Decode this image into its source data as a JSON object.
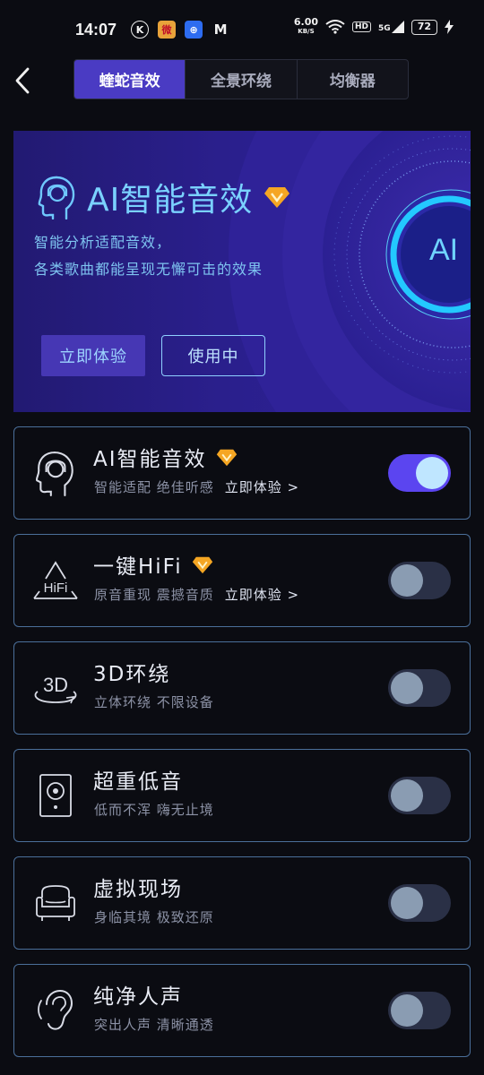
{
  "status_bar": {
    "time": "14:07",
    "app_icons": [
      "K",
      "微",
      "⊕",
      "M"
    ],
    "net_speed": "6.00",
    "net_unit": "KB/S",
    "hd": "HD",
    "signal": "5G",
    "battery": "72"
  },
  "tabs": [
    {
      "label": "蝰蛇音效",
      "active": true
    },
    {
      "label": "全景环绕",
      "active": false
    },
    {
      "label": "均衡器",
      "active": false
    }
  ],
  "banner": {
    "title": "AI智能音效",
    "desc_line1": "智能分析适配音效，",
    "desc_line2": "各类歌曲都能呈现无懈可击的效果",
    "try_button": "立即体验",
    "inuse_button": "使用中",
    "badge": "AI"
  },
  "effects": [
    {
      "title": "AI智能音效",
      "subtitle": "智能适配 绝佳听感",
      "link": "立即体验 >",
      "vip": true,
      "enabled": true,
      "icon": "ai-head-icon"
    },
    {
      "title": "一键HiFi",
      "subtitle": "原音重现 震撼音质",
      "link": "立即体验 >",
      "vip": true,
      "enabled": false,
      "icon": "hifi-icon"
    },
    {
      "title": "3D环绕",
      "subtitle": "立体环绕 不限设备",
      "link": "",
      "vip": false,
      "enabled": false,
      "icon": "3d-surround-icon"
    },
    {
      "title": "超重低音",
      "subtitle": "低而不浑 嗨无止境",
      "link": "",
      "vip": false,
      "enabled": false,
      "icon": "speaker-icon"
    },
    {
      "title": "虚拟现场",
      "subtitle": "身临其境 极致还原",
      "link": "",
      "vip": false,
      "enabled": false,
      "icon": "armchair-icon"
    },
    {
      "title": "纯净人声",
      "subtitle": "突出人声 清晰通透",
      "link": "",
      "vip": false,
      "enabled": false,
      "icon": "ear-icon"
    }
  ],
  "hifi_icon_text": "HiFi",
  "threed_icon_text": "3D",
  "colors": {
    "accent": "#4a3bc3",
    "toggle_on": "#5b45f0",
    "banner_text": "#7ad1ff",
    "card_border": "#4b6f9a"
  }
}
